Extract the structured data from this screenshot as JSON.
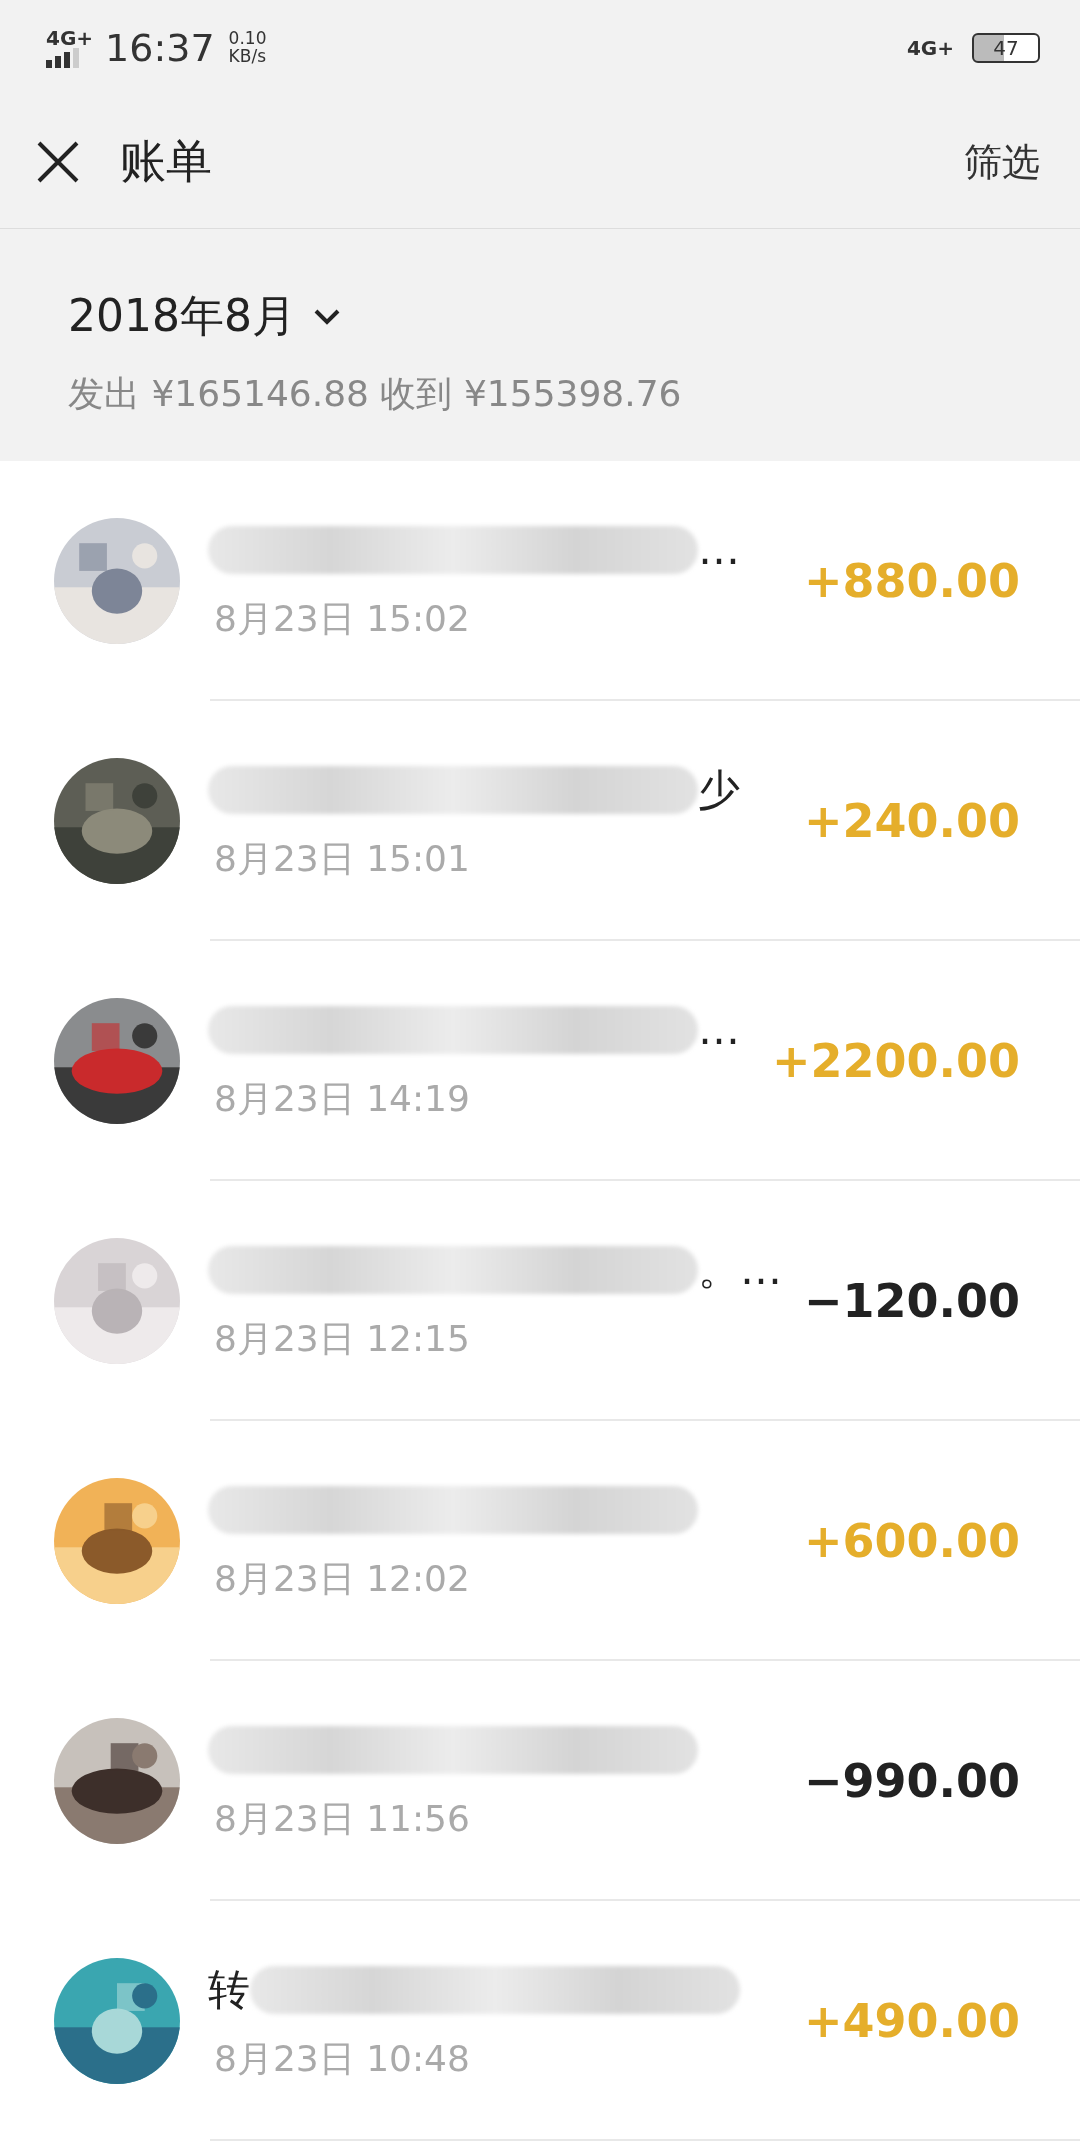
{
  "status_bar": {
    "network": "4G+",
    "time": "16:37",
    "speed": "0.10",
    "speed_unit": "KB/s",
    "network_right": "4G+",
    "battery": "47"
  },
  "header": {
    "title": "账单",
    "action": "筛选"
  },
  "summary": {
    "month": "2018年8月",
    "totals": "发出 ¥165146.88 收到 ¥155398.76"
  },
  "transactions": [
    {
      "title": [
        {
          "kind": "blur"
        },
        {
          "kind": "text",
          "text": "…"
        }
      ],
      "date": "8月23日 15:02",
      "amount": "+880.00",
      "kind": "income"
    },
    {
      "title": [
        {
          "kind": "blur"
        },
        {
          "kind": "text",
          "text": "少"
        }
      ],
      "date": "8月23日 15:01",
      "amount": "+240.00",
      "kind": "income"
    },
    {
      "title": [
        {
          "kind": "blur"
        },
        {
          "kind": "text",
          "text": "…"
        }
      ],
      "date": "8月23日 14:19",
      "amount": "+2200.00",
      "kind": "income"
    },
    {
      "title": [
        {
          "kind": "blur"
        },
        {
          "kind": "text",
          "text": "。…"
        }
      ],
      "date": "8月23日 12:15",
      "amount": "−120.00",
      "kind": "expense"
    },
    {
      "title": [
        {
          "kind": "blur"
        }
      ],
      "date": "8月23日 12:02",
      "amount": "+600.00",
      "kind": "income"
    },
    {
      "title": [
        {
          "kind": "blur"
        }
      ],
      "date": "8月23日 11:56",
      "amount": "−990.00",
      "kind": "expense"
    },
    {
      "title": [
        {
          "kind": "text",
          "text": "转"
        },
        {
          "kind": "blur"
        }
      ],
      "date": "8月23日 10:48",
      "amount": "+490.00",
      "kind": "income"
    }
  ]
}
